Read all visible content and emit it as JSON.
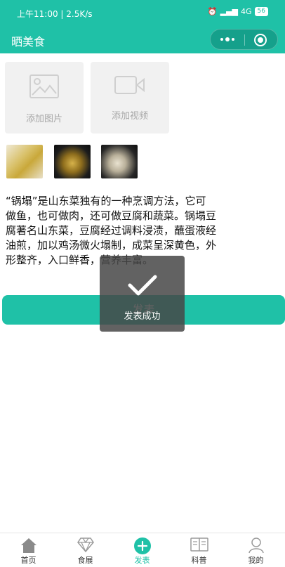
{
  "status_bar": {
    "time": "上午11:00 | 2.5K/s",
    "network": "4G",
    "battery": "56"
  },
  "nav": {
    "title": "晒美食"
  },
  "upload": {
    "add_image_label": "添加图片",
    "add_video_label": "添加视频"
  },
  "description": "“锅塌”是山东菜独有的一种烹调方法，它可做鱼，也可做肉，还可做豆腐和蔬菜。锅塌豆腐著名山东菜，豆腐经过调料浸渍，蘸蛋液经油煎，加以鸡汤微火塌制，成菜呈深黄色，外形整齐，入口鲜香，营养丰富。",
  "publish_button": "发表",
  "toast": {
    "text": "发表成功"
  },
  "tabs": [
    {
      "label": "首页",
      "icon": "home-icon"
    },
    {
      "label": "食展",
      "icon": "diamond-icon"
    },
    {
      "label": "发表",
      "icon": "plus-circle-icon"
    },
    {
      "label": "科普",
      "icon": "book-icon"
    },
    {
      "label": "我的",
      "icon": "user-icon"
    }
  ],
  "colors": {
    "accent": "#1fc1a7",
    "toast_bg": "#464646"
  }
}
